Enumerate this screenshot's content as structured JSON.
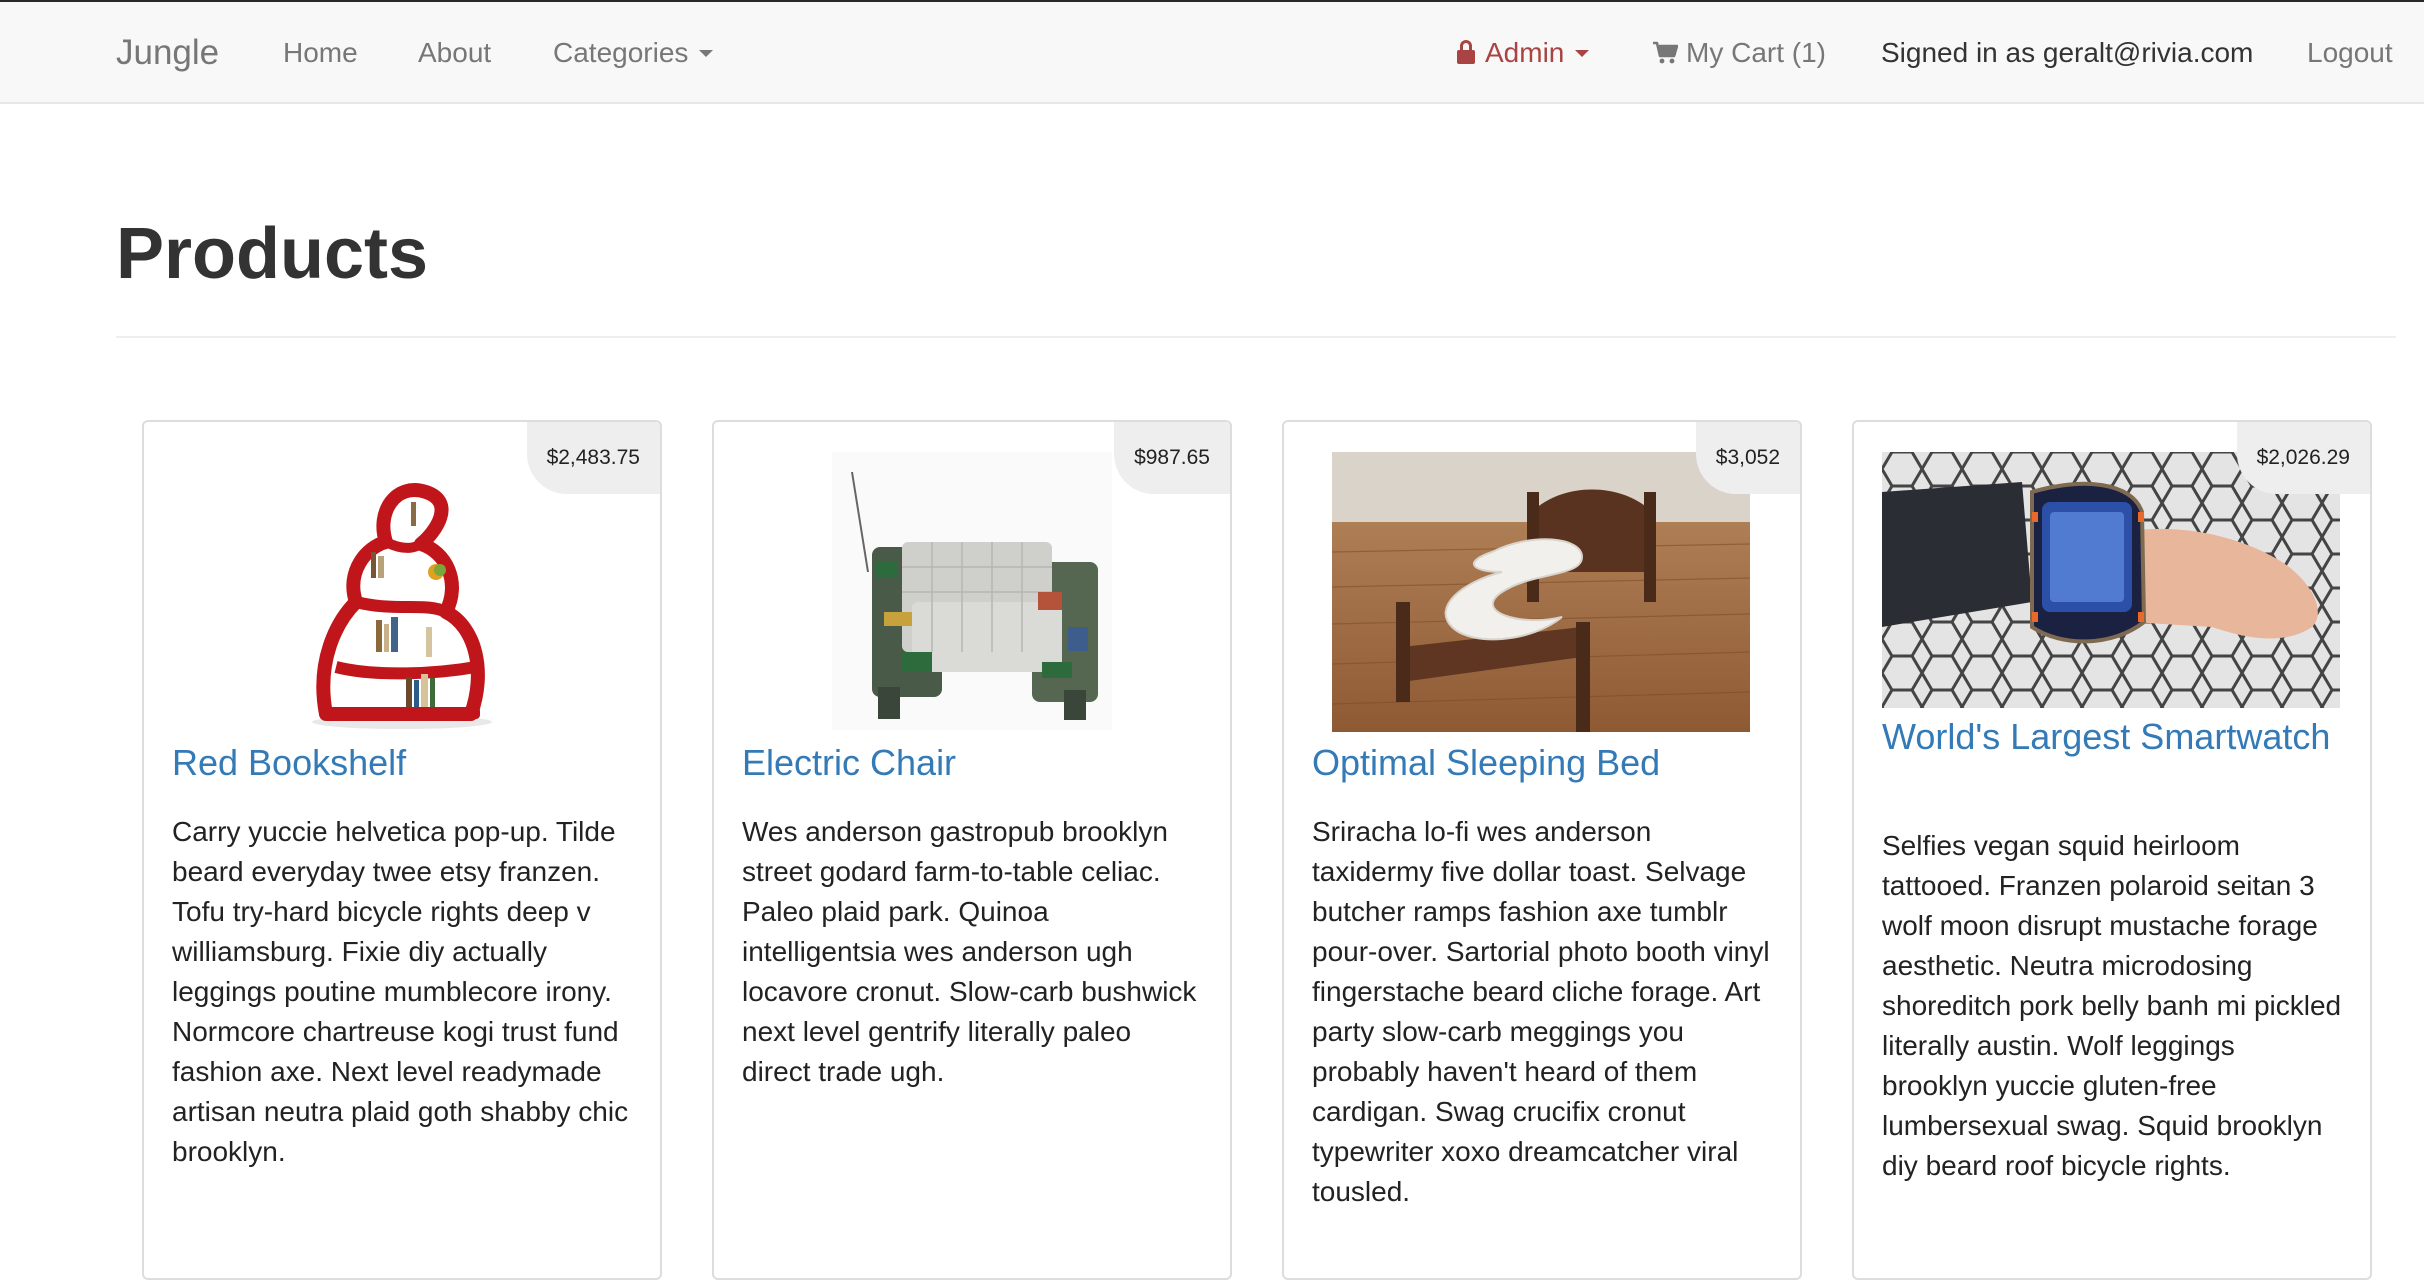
{
  "nav": {
    "brand": "Jungle",
    "home": "Home",
    "about": "About",
    "categories": "Categories",
    "admin": "Admin",
    "cart": "My Cart (1)",
    "signed_in": "Signed in as geralt@rivia.com",
    "logout": "Logout",
    "colors": {
      "admin": "#a94442",
      "link": "#777777"
    }
  },
  "page": {
    "title": "Products"
  },
  "products": [
    {
      "name": "Red Bookshelf",
      "price": "$2,483.75",
      "description": "Carry yuccie helvetica pop-up. Tilde beard everyday twee etsy franzen. Tofu try-hard bicycle rights deep v williamsburg. Fixie diy actually leggings poutine mumblecore irony. Normcore chartreuse kogi trust fund fashion axe. Next level readymade artisan neutra plaid goth shabby chic brooklyn."
    },
    {
      "name": "Electric Chair",
      "price": "$987.65",
      "description": "Wes anderson gastropub brooklyn street godard farm-to-table celiac. Paleo plaid park. Quinoa intelligentsia wes anderson ugh locavore cronut. Slow-carb bushwick next level gentrify literally paleo direct trade ugh."
    },
    {
      "name": "Optimal Sleeping Bed",
      "price": "$3,052",
      "description": "Sriracha lo-fi wes anderson taxidermy five dollar toast. Selvage butcher ramps fashion axe tumblr pour-over. Sartorial photo booth vinyl fingerstache beard cliche forage. Art party slow-carb meggings you probably haven't heard of them cardigan. Swag crucifix cronut typewriter xoxo dreamcatcher viral tousled."
    },
    {
      "name": "World's Largest Smartwatch",
      "price": "$2,026.29",
      "description": "Selfies vegan squid heirloom tattooed. Franzen polaroid seitan 3 wolf moon disrupt mustache forage aesthetic. Neutra microdosing shoreditch pork belly banh mi pickled literally austin. Wolf leggings brooklyn yuccie gluten-free lumbersexual swag. Squid brooklyn diy beard roof bicycle rights."
    }
  ]
}
